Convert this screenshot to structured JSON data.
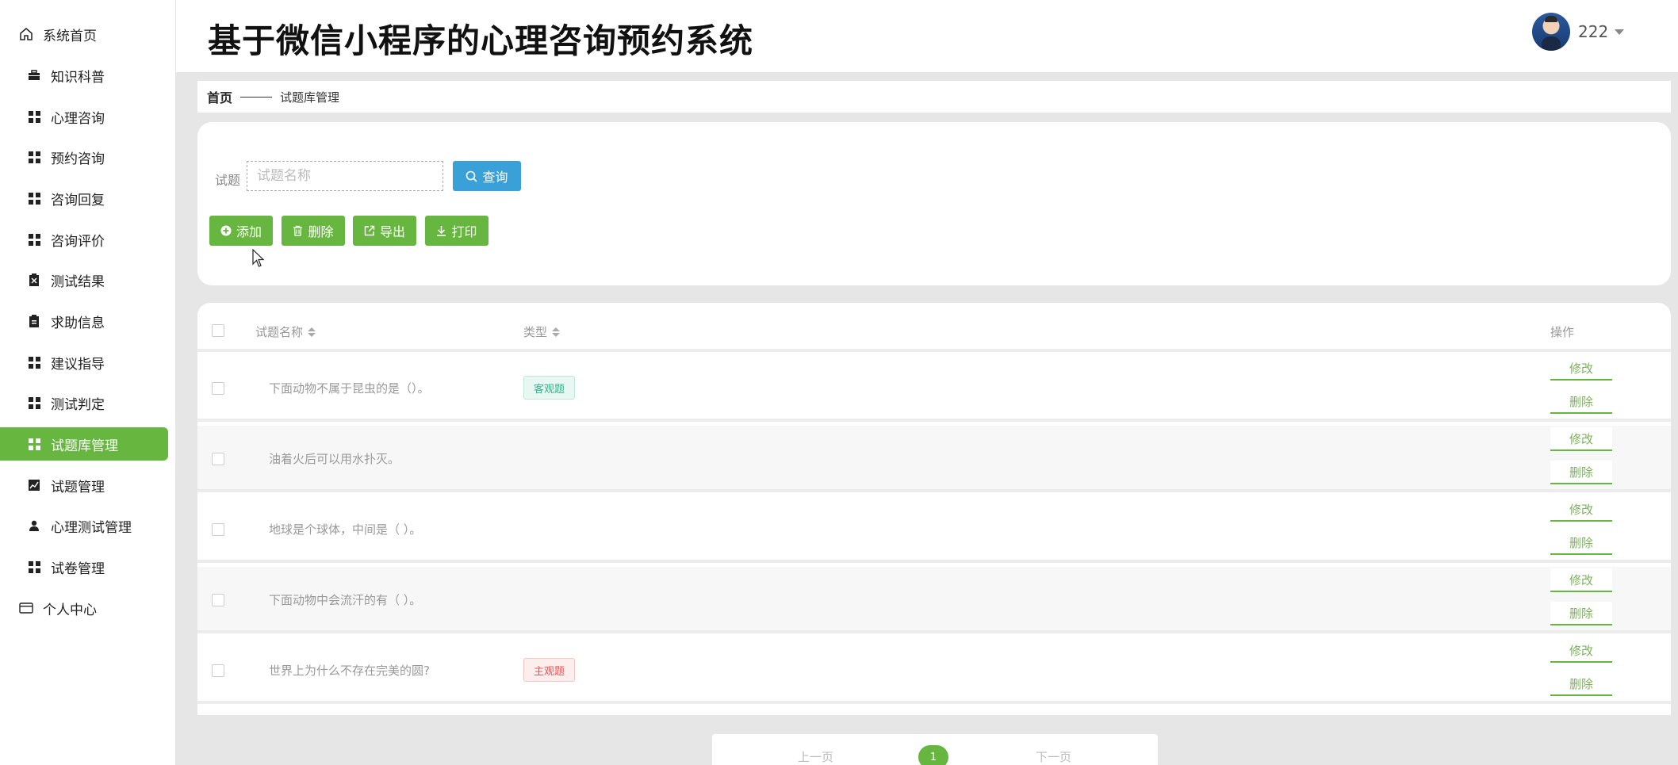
{
  "app": {
    "title": "基于微信小程序的心理咨询预约系统"
  },
  "user": {
    "name": "222"
  },
  "sidebar": {
    "items": [
      {
        "label": "系统首页",
        "icon": "home-icon"
      },
      {
        "label": "知识科普",
        "icon": "briefcase-icon"
      },
      {
        "label": "心理咨询",
        "icon": "grid-icon"
      },
      {
        "label": "预约咨询",
        "icon": "grid-icon"
      },
      {
        "label": "咨询回复",
        "icon": "grid-icon"
      },
      {
        "label": "咨询评价",
        "icon": "grid-icon"
      },
      {
        "label": "测试结果",
        "icon": "clipboard-x-icon"
      },
      {
        "label": "求助信息",
        "icon": "clipboard-icon"
      },
      {
        "label": "建议指导",
        "icon": "grid-icon"
      },
      {
        "label": "测试判定",
        "icon": "grid-icon"
      },
      {
        "label": "试题库管理",
        "icon": "grid-icon",
        "active": true
      },
      {
        "label": "试题管理",
        "icon": "chart-icon"
      },
      {
        "label": "心理测试管理",
        "icon": "user-icon"
      },
      {
        "label": "试卷管理",
        "icon": "grid-icon"
      },
      {
        "label": "个人中心",
        "icon": "card-icon"
      }
    ]
  },
  "breadcrumb": {
    "home": "首页",
    "current": "试题库管理"
  },
  "search": {
    "label": "试题",
    "placeholder": "试题名称",
    "query_label": "查询"
  },
  "toolbar": {
    "add_label": "添加",
    "delete_label": "删除",
    "export_label": "导出",
    "print_label": "打印"
  },
  "table": {
    "headers": {
      "name": "试题名称",
      "type": "类型",
      "actions": "操作"
    },
    "rows": [
      {
        "name": "下面动物不属于昆虫的是（）。",
        "type": "客观题"
      },
      {
        "name": "油着火后可以用水扑灭。",
        "type": ""
      },
      {
        "name": "地球是个球体，中间是（ ）。",
        "type": ""
      },
      {
        "name": "下面动物中会流汗的有（ ）。",
        "type": ""
      },
      {
        "name": "世界上为什么不存在完美的圆?",
        "type": "主观题"
      }
    ],
    "edit_label": "修改",
    "delete_label": "删除"
  },
  "pagination": {
    "prev": "上一页",
    "current": "1",
    "next": "下一页"
  },
  "colors": {
    "accent": "#67b63f",
    "query": "#3aa0d8"
  }
}
